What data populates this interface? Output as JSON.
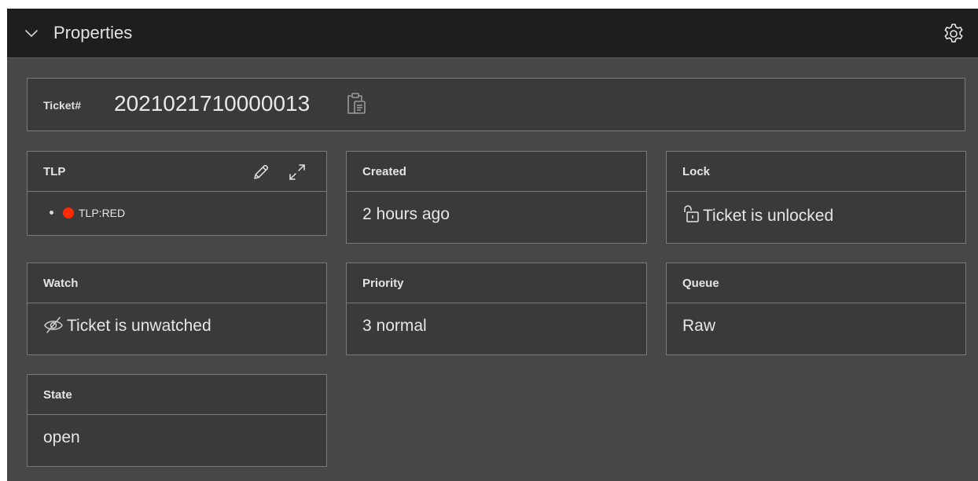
{
  "header": {
    "title": "Properties",
    "chevron_icon": "chevron-down-icon",
    "settings_icon": "gear-icon"
  },
  "ticket": {
    "label": "Ticket#",
    "number": "2021021710000013",
    "copy_icon": "clipboard-icon"
  },
  "cards": {
    "tlp": {
      "title": "TLP",
      "edit_icon": "pencil-icon",
      "expand_icon": "expand-icon",
      "value": "TLP:RED",
      "dot_color": "#ff2a00"
    },
    "created": {
      "title": "Created",
      "value": "2 hours ago"
    },
    "lock": {
      "title": "Lock",
      "value": "Ticket is unlocked",
      "icon": "unlock-icon"
    },
    "watch": {
      "title": "Watch",
      "value": "Ticket is unwatched",
      "icon": "eye-slash-icon"
    },
    "priority": {
      "title": "Priority",
      "value": "3 normal"
    },
    "queue": {
      "title": "Queue",
      "value": "Raw"
    },
    "state": {
      "title": "State",
      "value": "open"
    }
  },
  "colors": {
    "header_bg": "#1e1e1e",
    "panel_bg": "#474747",
    "card_bg": "#3a3a3a",
    "border": "#7a7a7a",
    "text": "#e6e6e6"
  }
}
